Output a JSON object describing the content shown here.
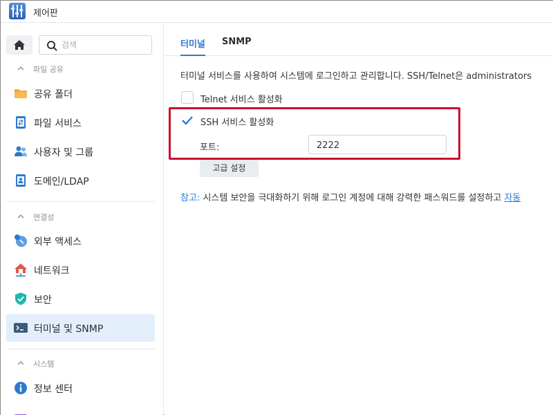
{
  "window": {
    "title": "제어판"
  },
  "sidebar": {
    "search_placeholder": "검색",
    "sections": {
      "file_sharing": "파일 공유",
      "connectivity": "연결성",
      "system": "시스템"
    },
    "items": [
      {
        "label": "공유 폴더",
        "icon": "folder-icon"
      },
      {
        "label": "파일 서비스",
        "icon": "file-services-icon"
      },
      {
        "label": "사용자 및 그룹",
        "icon": "users-icon"
      },
      {
        "label": "도메인/LDAP",
        "icon": "domain-icon"
      },
      {
        "label": "외부 액세스",
        "icon": "external-access-icon"
      },
      {
        "label": "네트워크",
        "icon": "network-icon"
      },
      {
        "label": "보안",
        "icon": "shield-icon"
      },
      {
        "label": "터미널 및 SNMP",
        "icon": "terminal-icon",
        "active": true
      },
      {
        "label": "정보 센터",
        "icon": "info-icon"
      }
    ]
  },
  "tabs": [
    {
      "label": "터미널",
      "active": true
    },
    {
      "label": "SNMP",
      "active": false
    }
  ],
  "terminal": {
    "description": "터미널 서비스를 사용하여 시스템에 로그인하고 관리합니다. SSH/Telnet은 administrators",
    "telnet": {
      "label": "Telnet 서비스 활성화",
      "checked": false
    },
    "ssh": {
      "label": "SSH 서비스 활성화",
      "checked": true
    },
    "port_label": "포트:",
    "port_value": "2222",
    "advanced_button": "고급 설정",
    "note_prefix": "참고:",
    "note_text": " 시스템 보안을 극대화하기 위해 로그인 계정에 대해 강력한 패스워드를 설정하고 ",
    "note_link": "자동"
  },
  "colors": {
    "accent": "#2e7ad1",
    "highlight_box": "#c8102e",
    "active_item_bg": "#e3eefb"
  }
}
